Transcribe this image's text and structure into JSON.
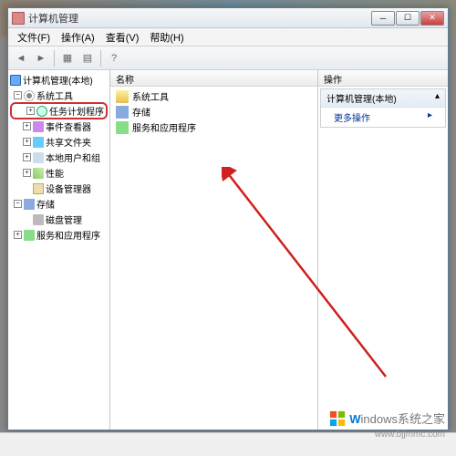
{
  "window": {
    "title": "计算机管理"
  },
  "menubar": [
    {
      "label": "文件(F)"
    },
    {
      "label": "操作(A)"
    },
    {
      "label": "查看(V)"
    },
    {
      "label": "帮助(H)"
    }
  ],
  "tree": {
    "root": "计算机管理(本地)",
    "groups": [
      {
        "label": "系统工具",
        "children": [
          {
            "label": "任务计划程序",
            "highlighted": true
          },
          {
            "label": "事件查看器"
          },
          {
            "label": "共享文件夹"
          },
          {
            "label": "本地用户和组"
          },
          {
            "label": "性能"
          },
          {
            "label": "设备管理器"
          }
        ]
      },
      {
        "label": "存储",
        "children": [
          {
            "label": "磁盘管理"
          }
        ]
      },
      {
        "label": "服务和应用程序",
        "children": []
      }
    ]
  },
  "list": {
    "header": "名称",
    "items": [
      {
        "label": "系统工具",
        "icon": "folder"
      },
      {
        "label": "存储",
        "icon": "storage"
      },
      {
        "label": "服务和应用程序",
        "icon": "app"
      }
    ]
  },
  "actions": {
    "header": "操作",
    "section_title": "计算机管理(本地)",
    "more": "更多操作",
    "chevron": "▴"
  },
  "watermark": {
    "brand_prefix": "W",
    "brand_rest": "indows",
    "site": "系统之家",
    "url": "www.bjjmmc.com"
  }
}
